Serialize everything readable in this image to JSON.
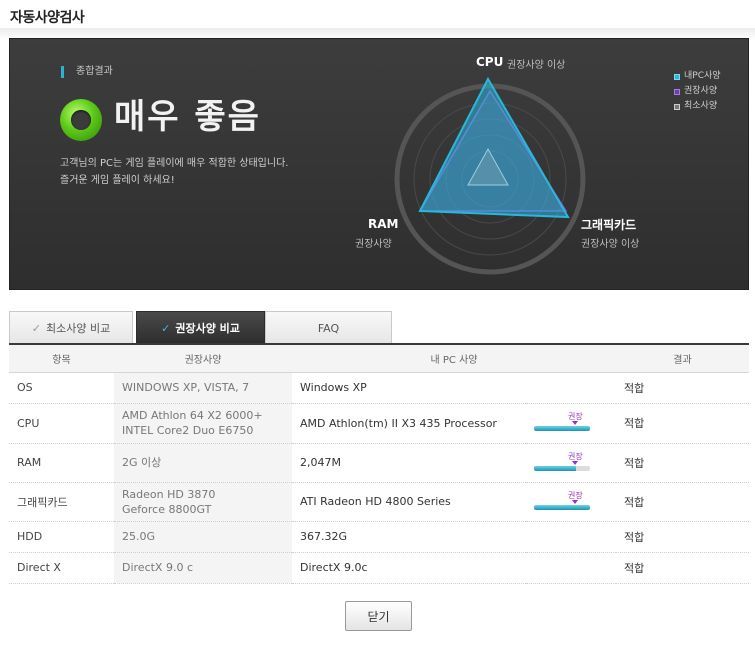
{
  "page": {
    "title": "자동사양검사"
  },
  "summary": {
    "label": "종합결과",
    "verdict": "매우 좋음",
    "desc_line1": "고객님의 PC는 게임 플레이에 매우 적합한 상태입니다.",
    "desc_line2": "즐거운 게임 플레이 하세요!"
  },
  "radar": {
    "axes": [
      {
        "name": "CPU",
        "sub": "권장사양 이상"
      },
      {
        "name": "그래픽카드",
        "sub": "권장사양 이상"
      },
      {
        "name": "RAM",
        "sub": "권장사양"
      }
    ],
    "colors": {
      "my_pc": "#2ab7dc",
      "recommended": "#8e5bd1",
      "minimum": "#cccccc"
    }
  },
  "legend": {
    "my_pc": "내PC사양",
    "recommended": "권장사양",
    "minimum": "최소사양"
  },
  "tabs": [
    {
      "label": "최소사양 비교"
    },
    {
      "label": "권장사양 비교"
    },
    {
      "label": "FAQ"
    }
  ],
  "table": {
    "headers": {
      "item": "항목",
      "recommended": "권장사양",
      "my_pc": "내 PC 사양",
      "result": "결과"
    },
    "rows": [
      {
        "item": "OS",
        "rec1": "WINDOWS XP,  VISTA,  7",
        "rec2": "",
        "my": "Windows XP",
        "bar_label": "",
        "level": null,
        "result": "적합"
      },
      {
        "item": "CPU",
        "rec1": "AMD Athlon 64 X2 6000+",
        "rec2": "INTEL Core2 Duo E6750",
        "my": "AMD Athlon(tm) II X3 435 Processor",
        "bar_label": "권장",
        "level": 1.0,
        "marker": 0.75,
        "result": "적합"
      },
      {
        "item": "RAM",
        "rec1": "2G 이상",
        "rec2": "",
        "my": "2,047M",
        "bar_label": "권장",
        "level": 0.75,
        "marker": 0.75,
        "result": "적합"
      },
      {
        "item": "그래픽카드",
        "rec1": "Radeon HD 3870",
        "rec2": "Geforce 8800GT",
        "my": "ATI Radeon HD 4800 Series",
        "bar_label": "권장",
        "level": 1.0,
        "marker": 0.75,
        "result": "적합"
      },
      {
        "item": "HDD",
        "rec1": "25.0G",
        "rec2": "",
        "my": "367.32G",
        "bar_label": "",
        "level": null,
        "result": "적합"
      },
      {
        "item": "Direct X",
        "rec1": "DirectX 9.0 c",
        "rec2": "",
        "my": "DirectX 9.0c",
        "bar_label": "",
        "level": null,
        "result": "적합"
      }
    ]
  },
  "footer": {
    "close_label": "닫기"
  }
}
